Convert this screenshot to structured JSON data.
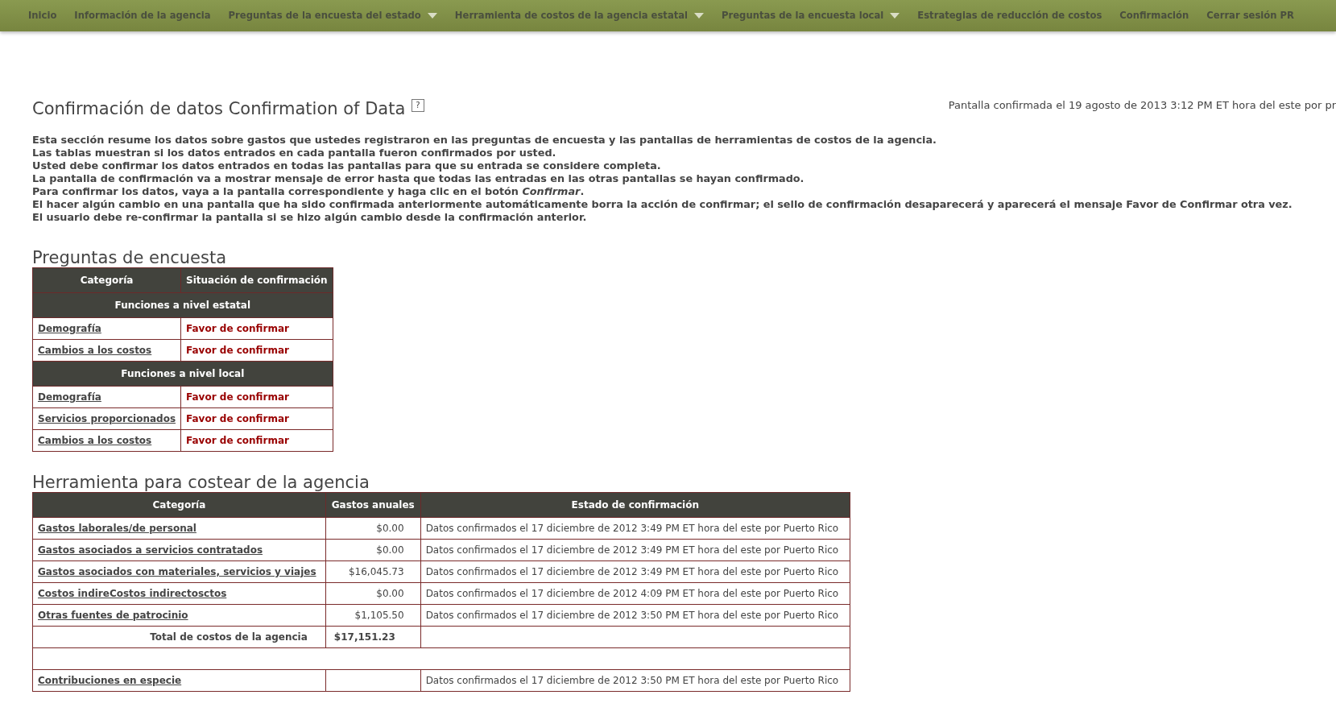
{
  "nav": [
    {
      "label": "Inicio",
      "dropdown": false
    },
    {
      "label": "Información de la agencia",
      "dropdown": false
    },
    {
      "label": "Preguntas de la encuesta del estado",
      "dropdown": true
    },
    {
      "label": "Herramienta de costos de la agencia estatal",
      "dropdown": true
    },
    {
      "label": "Preguntas de la encuesta local",
      "dropdown": true
    },
    {
      "label": "Estrategias de reducción de costos",
      "dropdown": false
    },
    {
      "label": "Confirmación",
      "dropdown": false
    },
    {
      "label": "Cerrar sesión PR",
      "dropdown": false
    }
  ],
  "page": {
    "title": "Confirmación de datos Confirmation of Data",
    "help": "?",
    "confirmed_note": "Pantalla confirmada el 19 agosto de 2013 3:12 PM ET hora del este por pr"
  },
  "intro": [
    "Esta sección resume los datos sobre gastos que ustedes registraron en las preguntas de encuesta y las pantallas de herramientas de costos de la agencia.",
    "Las tablas muestran si los datos entrados en cada pantalla fueron confirmados por usted.",
    "Usted debe confirmar los datos entrados en todas las pantallas para que su entrada se considere completa.",
    "La pantalla de confirmación va a mostrar mensaje de error hasta que todas las entradas en las otras pantallas se hayan confirmado.",
    "Para confirmar los datos, vaya a la pantalla correspondiente y haga clic en el botón *Confirmar*.",
    "El hacer algún cambio en una pantalla que ha sido confirmada anteriormente automáticamente borra la acción de confirmar; el sello de confirmación desaparecerá y aparecerá el mensaje Favor de Confirmar otra vez.",
    "El usuario debe re-confirmar la pantalla si se hizo algún cambio desde la confirmación anterior."
  ],
  "survey": {
    "heading": "Preguntas de encuesta",
    "columns": [
      "Categoría",
      "Situación de confirmación"
    ],
    "rows": [
      {
        "kind": "group",
        "label": "Funciones a nivel estatal"
      },
      {
        "kind": "item",
        "category": "Demografía",
        "status": "Favor de confirmar",
        "confirmed": false
      },
      {
        "kind": "item",
        "category": "Cambios a los costos",
        "status": "Favor de confirmar",
        "confirmed": false
      },
      {
        "kind": "group",
        "label": "Funciones a nivel local"
      },
      {
        "kind": "item",
        "category": "Demografía",
        "status": "Favor de confirmar",
        "confirmed": false
      },
      {
        "kind": "item",
        "category": "Servicios proporcionados",
        "status": "Favor de confirmar",
        "confirmed": false
      },
      {
        "kind": "item",
        "category": "Cambios a los costos",
        "status": "Favor de confirmar",
        "confirmed": false
      }
    ]
  },
  "costs": {
    "heading": "Herramienta para costear de la agencia",
    "columns": [
      "Categoría",
      "Gastos anuales",
      "Estado de confirmación"
    ],
    "rows": [
      {
        "kind": "item",
        "category": "Gastos laborales/de personal",
        "amount": "$0.00",
        "status": "Datos confirmados el 17 diciembre de 2012 3:49 PM ET hora del este por Puerto Rico"
      },
      {
        "kind": "item",
        "category": "Gastos asociados a servicios contratados",
        "amount": "$0.00",
        "status": "Datos confirmados el 17 diciembre de 2012 3:49 PM ET hora del este por Puerto Rico"
      },
      {
        "kind": "item",
        "category": "Gastos asociados con materiales, servicios y viajes",
        "amount": "$16,045.73",
        "status": "Datos confirmados el 17 diciembre de 2012 3:49 PM ET hora del este por Puerto Rico"
      },
      {
        "kind": "item",
        "category": "Costos indireCostos indirectosctos",
        "amount": "$0.00",
        "status": "Datos confirmados el 17 diciembre de 2012 4:09 PM ET hora del este por Puerto Rico"
      },
      {
        "kind": "item",
        "category": "Otras fuentes de patrocinio",
        "amount": "$1,105.50",
        "status": "Datos confirmados el 17 diciembre de 2012 3:50 PM ET hora del este por Puerto Rico"
      },
      {
        "kind": "total",
        "label": "Total de costos de la agencia",
        "amount": "$17,151.23"
      },
      {
        "kind": "spacer"
      },
      {
        "kind": "item",
        "category": "Contribuciones en especie",
        "status": "Datos confirmados el 17 diciembre de 2012 3:50 PM ET hora del este por Puerto Rico"
      }
    ]
  }
}
